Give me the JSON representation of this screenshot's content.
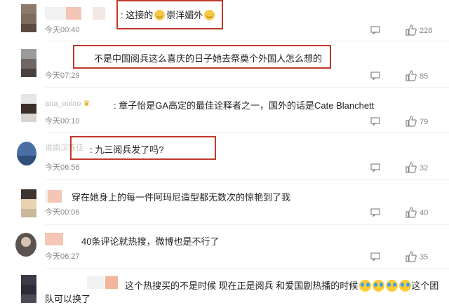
{
  "comments": [
    {
      "sep": ":",
      "text": "这接的",
      "emoji_after": "崇洋媚外",
      "time": "今天00:40",
      "likes": "226"
    },
    {
      "text": "不是中国阅兵这么喜庆的日子她去祭奠个外国人怎么想的",
      "time": "今天07:29",
      "likes": "85"
    },
    {
      "username": "ana_ooino",
      "sep": ":",
      "text": "章子怡是GA高定的最佳诠释者之一，国外的话是Cate Blanchett",
      "time": "今天00:10",
      "likes": "79"
    },
    {
      "username": "谁娟汉陈佳",
      "sep": ":",
      "text": "九三阅兵发了吗?",
      "time": "今天06:56",
      "likes": "32"
    },
    {
      "text": "穿在她身上的每一件阿玛尼造型都无数次的惊艳到了我",
      "time": "今天00:06",
      "likes": "40"
    },
    {
      "text": "40条评论就热搜，微博也是不行了",
      "time": "今天06:27",
      "likes": "35"
    },
    {
      "text": "这个热搜买的不是时候 现在正是阅兵 和爱国剧热播的时候",
      "text_end": "这个团",
      "text_line2": "队可以换了"
    }
  ],
  "colors": {
    "highlight_box": "#c0392b",
    "meta_text": "#888888",
    "comment_text": "#222222"
  },
  "icons": {
    "reply": "comment-bubble-icon",
    "like": "thumbs-up-icon"
  }
}
